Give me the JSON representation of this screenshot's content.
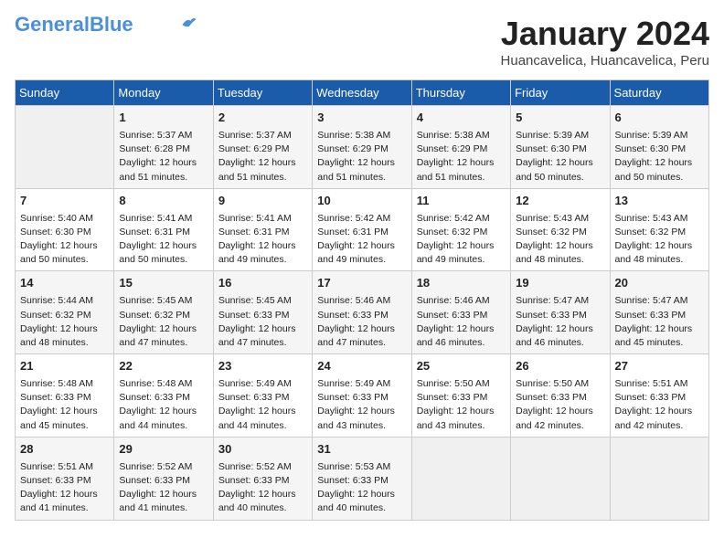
{
  "logo": {
    "part1": "General",
    "part2": "Blue"
  },
  "title": "January 2024",
  "location": "Huancavelica, Huancavelica, Peru",
  "days_of_week": [
    "Sunday",
    "Monday",
    "Tuesday",
    "Wednesday",
    "Thursday",
    "Friday",
    "Saturday"
  ],
  "weeks": [
    [
      {
        "day": "",
        "content": ""
      },
      {
        "day": "1",
        "content": "Sunrise: 5:37 AM\nSunset: 6:28 PM\nDaylight: 12 hours\nand 51 minutes."
      },
      {
        "day": "2",
        "content": "Sunrise: 5:37 AM\nSunset: 6:29 PM\nDaylight: 12 hours\nand 51 minutes."
      },
      {
        "day": "3",
        "content": "Sunrise: 5:38 AM\nSunset: 6:29 PM\nDaylight: 12 hours\nand 51 minutes."
      },
      {
        "day": "4",
        "content": "Sunrise: 5:38 AM\nSunset: 6:29 PM\nDaylight: 12 hours\nand 51 minutes."
      },
      {
        "day": "5",
        "content": "Sunrise: 5:39 AM\nSunset: 6:30 PM\nDaylight: 12 hours\nand 50 minutes."
      },
      {
        "day": "6",
        "content": "Sunrise: 5:39 AM\nSunset: 6:30 PM\nDaylight: 12 hours\nand 50 minutes."
      }
    ],
    [
      {
        "day": "7",
        "content": "Sunrise: 5:40 AM\nSunset: 6:30 PM\nDaylight: 12 hours\nand 50 minutes."
      },
      {
        "day": "8",
        "content": "Sunrise: 5:41 AM\nSunset: 6:31 PM\nDaylight: 12 hours\nand 50 minutes."
      },
      {
        "day": "9",
        "content": "Sunrise: 5:41 AM\nSunset: 6:31 PM\nDaylight: 12 hours\nand 49 minutes."
      },
      {
        "day": "10",
        "content": "Sunrise: 5:42 AM\nSunset: 6:31 PM\nDaylight: 12 hours\nand 49 minutes."
      },
      {
        "day": "11",
        "content": "Sunrise: 5:42 AM\nSunset: 6:32 PM\nDaylight: 12 hours\nand 49 minutes."
      },
      {
        "day": "12",
        "content": "Sunrise: 5:43 AM\nSunset: 6:32 PM\nDaylight: 12 hours\nand 48 minutes."
      },
      {
        "day": "13",
        "content": "Sunrise: 5:43 AM\nSunset: 6:32 PM\nDaylight: 12 hours\nand 48 minutes."
      }
    ],
    [
      {
        "day": "14",
        "content": "Sunrise: 5:44 AM\nSunset: 6:32 PM\nDaylight: 12 hours\nand 48 minutes."
      },
      {
        "day": "15",
        "content": "Sunrise: 5:45 AM\nSunset: 6:32 PM\nDaylight: 12 hours\nand 47 minutes."
      },
      {
        "day": "16",
        "content": "Sunrise: 5:45 AM\nSunset: 6:33 PM\nDaylight: 12 hours\nand 47 minutes."
      },
      {
        "day": "17",
        "content": "Sunrise: 5:46 AM\nSunset: 6:33 PM\nDaylight: 12 hours\nand 47 minutes."
      },
      {
        "day": "18",
        "content": "Sunrise: 5:46 AM\nSunset: 6:33 PM\nDaylight: 12 hours\nand 46 minutes."
      },
      {
        "day": "19",
        "content": "Sunrise: 5:47 AM\nSunset: 6:33 PM\nDaylight: 12 hours\nand 46 minutes."
      },
      {
        "day": "20",
        "content": "Sunrise: 5:47 AM\nSunset: 6:33 PM\nDaylight: 12 hours\nand 45 minutes."
      }
    ],
    [
      {
        "day": "21",
        "content": "Sunrise: 5:48 AM\nSunset: 6:33 PM\nDaylight: 12 hours\nand 45 minutes."
      },
      {
        "day": "22",
        "content": "Sunrise: 5:48 AM\nSunset: 6:33 PM\nDaylight: 12 hours\nand 44 minutes."
      },
      {
        "day": "23",
        "content": "Sunrise: 5:49 AM\nSunset: 6:33 PM\nDaylight: 12 hours\nand 44 minutes."
      },
      {
        "day": "24",
        "content": "Sunrise: 5:49 AM\nSunset: 6:33 PM\nDaylight: 12 hours\nand 43 minutes."
      },
      {
        "day": "25",
        "content": "Sunrise: 5:50 AM\nSunset: 6:33 PM\nDaylight: 12 hours\nand 43 minutes."
      },
      {
        "day": "26",
        "content": "Sunrise: 5:50 AM\nSunset: 6:33 PM\nDaylight: 12 hours\nand 42 minutes."
      },
      {
        "day": "27",
        "content": "Sunrise: 5:51 AM\nSunset: 6:33 PM\nDaylight: 12 hours\nand 42 minutes."
      }
    ],
    [
      {
        "day": "28",
        "content": "Sunrise: 5:51 AM\nSunset: 6:33 PM\nDaylight: 12 hours\nand 41 minutes."
      },
      {
        "day": "29",
        "content": "Sunrise: 5:52 AM\nSunset: 6:33 PM\nDaylight: 12 hours\nand 41 minutes."
      },
      {
        "day": "30",
        "content": "Sunrise: 5:52 AM\nSunset: 6:33 PM\nDaylight: 12 hours\nand 40 minutes."
      },
      {
        "day": "31",
        "content": "Sunrise: 5:53 AM\nSunset: 6:33 PM\nDaylight: 12 hours\nand 40 minutes."
      },
      {
        "day": "",
        "content": ""
      },
      {
        "day": "",
        "content": ""
      },
      {
        "day": "",
        "content": ""
      }
    ]
  ]
}
